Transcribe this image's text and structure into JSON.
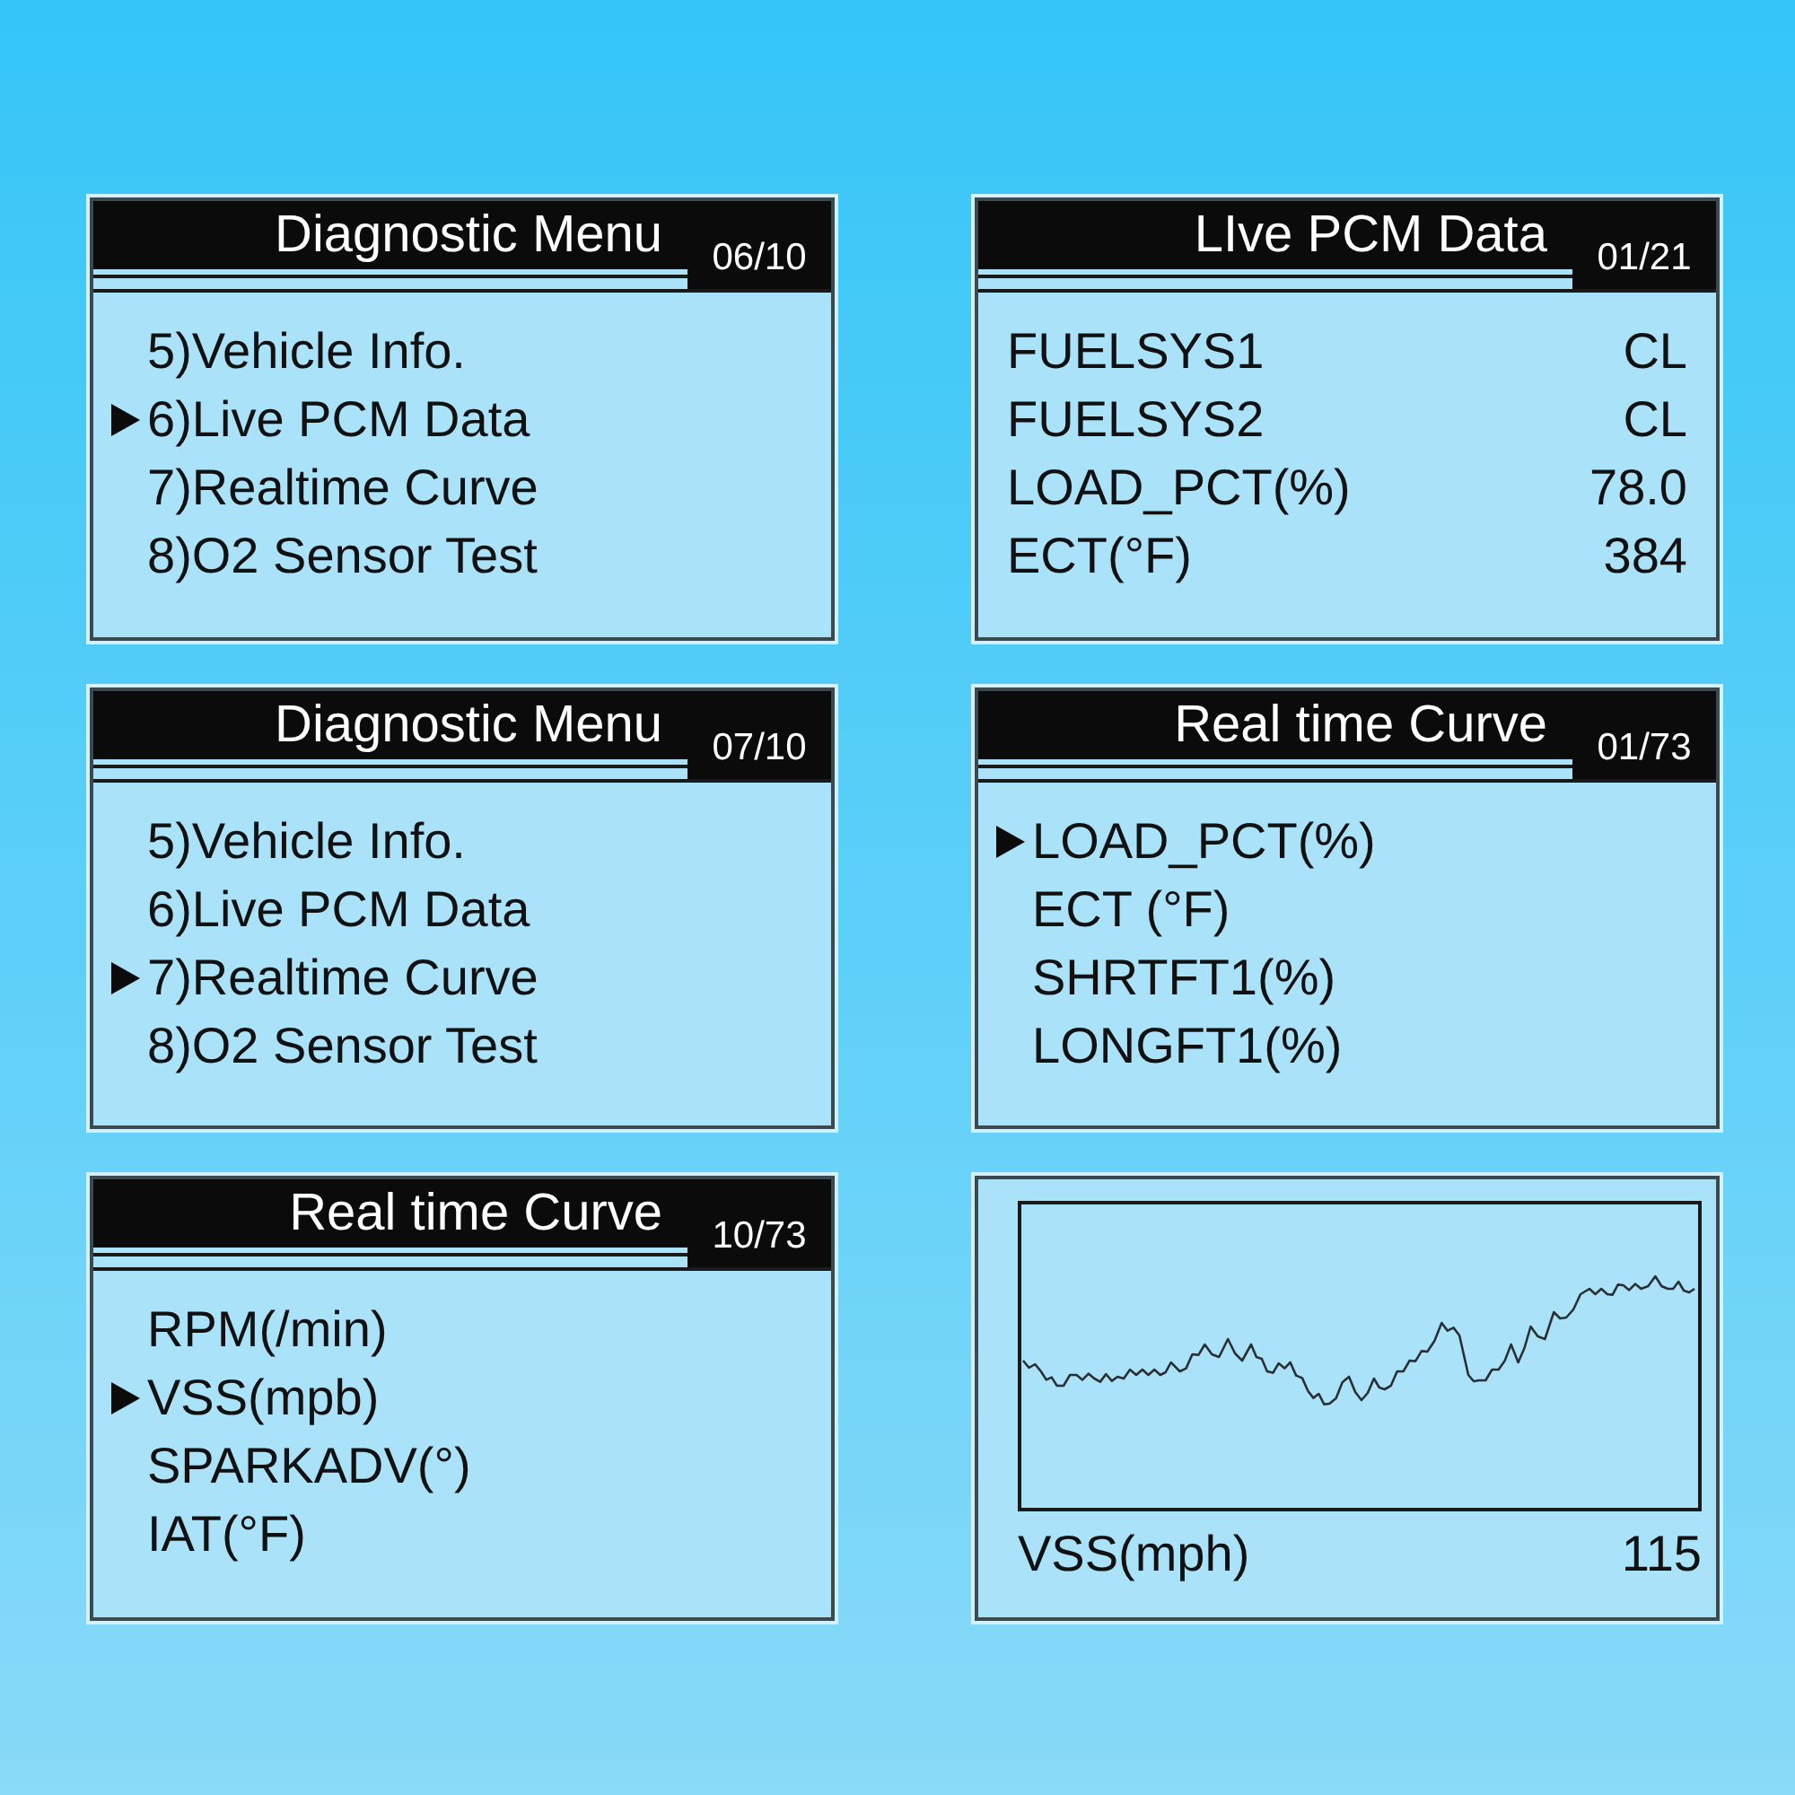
{
  "screens": [
    {
      "kind": "menu",
      "title": "Diagnostic Menu",
      "counter": "06/10",
      "items": [
        {
          "label": "5)Vehicle Info.",
          "selected": false
        },
        {
          "label": "6)Live PCM Data",
          "selected": true
        },
        {
          "label": "7)Realtime Curve",
          "selected": false
        },
        {
          "label": "8)O2 Sensor Test",
          "selected": false
        }
      ]
    },
    {
      "kind": "data",
      "title": "LIve PCM Data",
      "counter": "01/21",
      "rows": [
        {
          "label": "FUELSYS1",
          "value": "CL"
        },
        {
          "label": "FUELSYS2",
          "value": "CL"
        },
        {
          "label": "LOAD_PCT(%)",
          "value": "78.0"
        },
        {
          "label": "ECT(°F)",
          "value": "384"
        }
      ]
    },
    {
      "kind": "menu",
      "title": "Diagnostic Menu",
      "counter": "07/10",
      "items": [
        {
          "label": "5)Vehicle Info.",
          "selected": false
        },
        {
          "label": "6)Live PCM Data",
          "selected": false
        },
        {
          "label": "7)Realtime Curve",
          "selected": true
        },
        {
          "label": "8)O2 Sensor Test",
          "selected": false
        }
      ]
    },
    {
      "kind": "menu",
      "title": "Real time Curve",
      "counter": "01/73",
      "items": [
        {
          "label": "LOAD_PCT(%)",
          "selected": true
        },
        {
          "label": "ECT (°F)",
          "selected": false
        },
        {
          "label": "SHRTFT1(%)",
          "selected": false
        },
        {
          "label": "LONGFT1(%)",
          "selected": false
        }
      ]
    },
    {
      "kind": "menu",
      "title": "Real time Curve",
      "counter": "10/73",
      "items": [
        {
          "label": "RPM(/min)",
          "selected": false
        },
        {
          "label": "VSS(mpb)",
          "selected": true
        },
        {
          "label": "SPARKADV(°)",
          "selected": false
        },
        {
          "label": "IAT(°F)",
          "selected": false
        }
      ]
    },
    {
      "kind": "graph",
      "label": "VSS(mph)",
      "value": "115"
    }
  ]
}
